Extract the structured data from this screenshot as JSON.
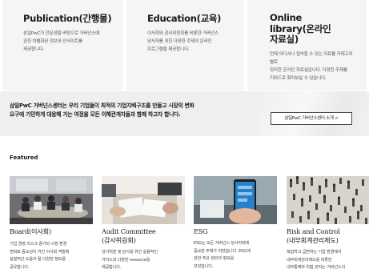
{
  "cards": [
    {
      "title": "Publication(간행물)",
      "desc_lines": [
        "삼일PwC가 전문성을 바탕으로 거버넌스에",
        "관한 차별화된 정보와 인사이트를",
        "제공합니다."
      ]
    },
    {
      "title": "Education(교육)",
      "desc_lines": [
        "이사회와 감사위원회를 비롯한 거버넌스",
        "당사자를 위한 다양한 주제의 온라인",
        "프로그램을 제공합니다."
      ]
    },
    {
      "title_lines": [
        "Online",
        "library(온라인",
        "자료실)"
      ],
      "desc_lines": [
        "언제 어디서나 접속할 수 있는 자료를 카테고리별로",
        "정리한 온라인 자료실입니다. 다양한 주제를",
        "키워드로 찾아보실 수 있습니다."
      ]
    }
  ],
  "banner": {
    "text_lines": [
      "삼일PwC 거버넌스센터는 우리 기업들이 최적의 기업지배구조를 만들고 시장의 변화",
      "요구에 기민하게 대응해 가는 여정을 모든 이해관계자들과 함께 하고자 합니다."
    ],
    "button_label": "삼일PwC 거버넌스센터 소개 >"
  },
  "featured": {
    "title": "Featured",
    "items": [
      {
        "title_lines": [
          "Board(이사회)"
        ],
        "desc_lines": [
          "기업 경영 리스크 증가와 시장 환경",
          "변화로 중요성이 커진 이사회 역할에",
          "실질적인 도움이 될 다양한 정보를",
          "공유합니다."
        ]
      },
      {
        "title_lines": [
          "Audit Committee",
          "(감사위원회)"
        ],
        "desc_lines": [
          "감사위원 및 감사를 위한 실용적인",
          "가이드와 다양한 resource를",
          "제공합니다."
        ]
      },
      {
        "title_lines": [
          "ESG"
        ],
        "desc_lines": [
          "ESG는 모든 거버넌스 당사자에게",
          "중요한 주제가 되었습니다. ESG에",
          "관한 주요 현안과 정보를",
          "모았습니다."
        ]
      },
      {
        "title_lines": [
          "Risk and Control",
          "(내부회계관리제도)"
        ],
        "desc_lines": [
          "복잡하고 급변하는 기업 환경에서",
          "내부회계관리제도를 비롯한",
          "내부통제와 위험 관리는 거버넌스의"
        ]
      }
    ]
  }
}
